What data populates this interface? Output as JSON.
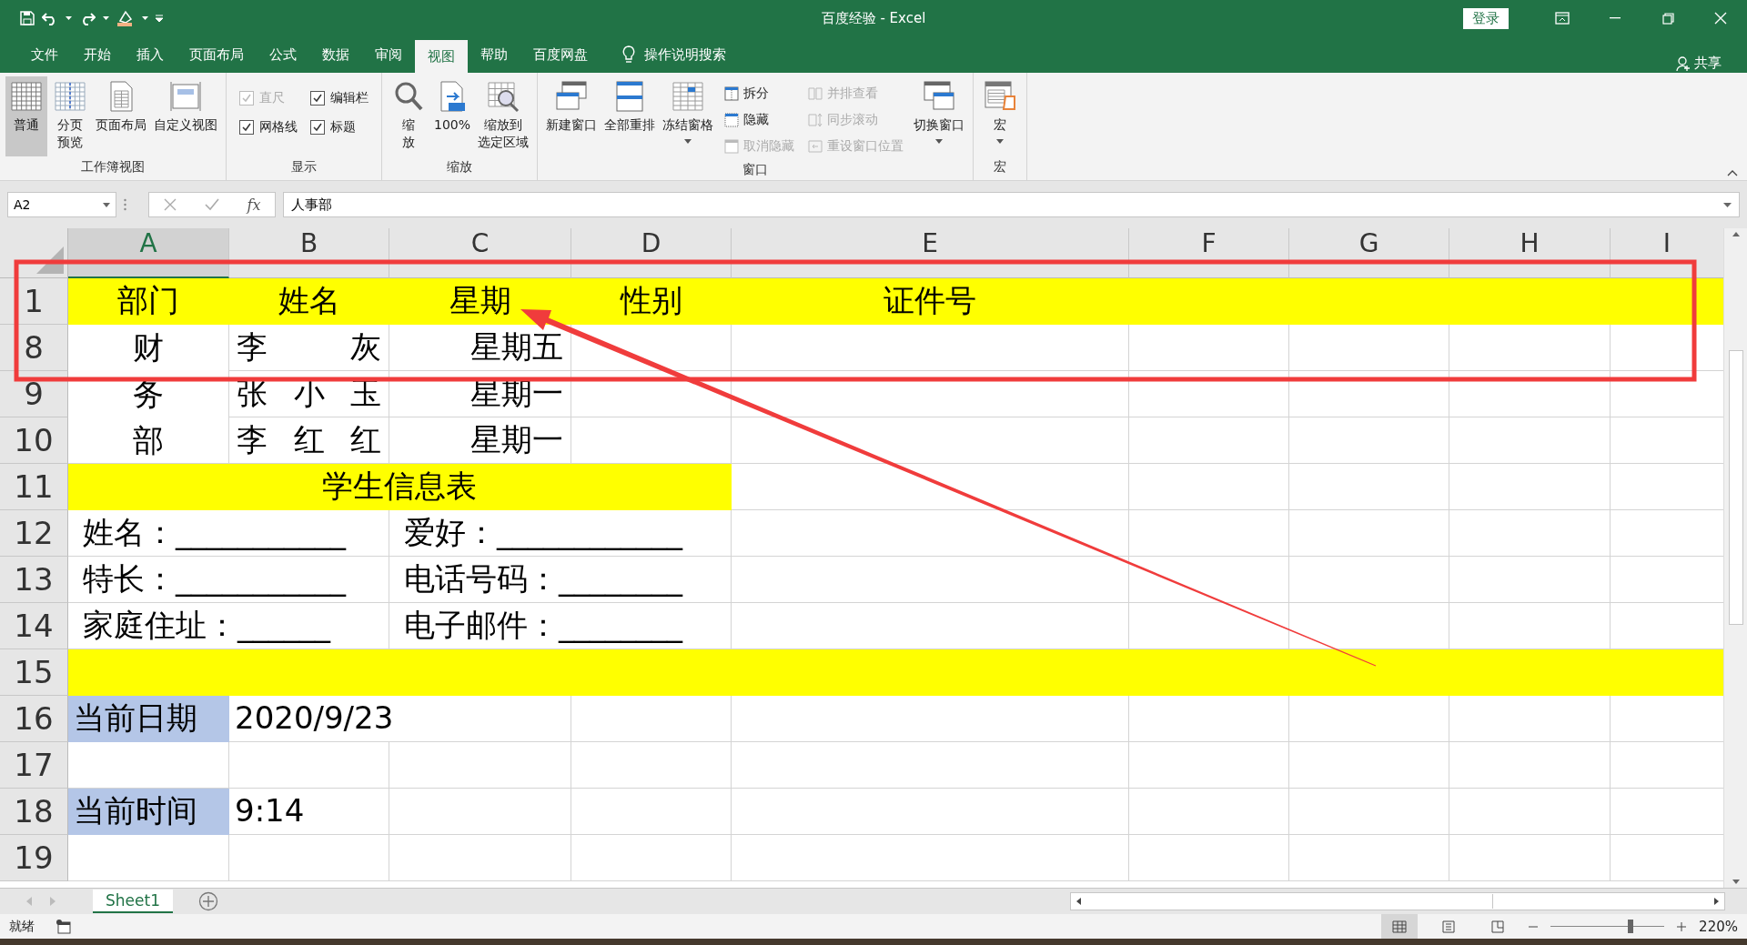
{
  "window": {
    "title": "百度经验 - Excel",
    "sign_in": "登录"
  },
  "ribbon_tabs": [
    {
      "label": "文件",
      "selected": false
    },
    {
      "label": "开始",
      "selected": false
    },
    {
      "label": "插入",
      "selected": false
    },
    {
      "label": "页面布局",
      "selected": false
    },
    {
      "label": "公式",
      "selected": false
    },
    {
      "label": "数据",
      "selected": false
    },
    {
      "label": "审阅",
      "selected": false
    },
    {
      "label": "视图",
      "selected": true
    },
    {
      "label": "帮助",
      "selected": false
    },
    {
      "label": "百度网盘",
      "selected": false
    }
  ],
  "tell_me": "操作说明搜索",
  "share": "共享",
  "ribbon_groups": [
    {
      "label": "工作簿视图",
      "items": [
        {
          "kind": "large",
          "label": "普通",
          "selected": true
        },
        {
          "kind": "large",
          "lines": [
            "分页",
            "预览"
          ],
          "selected": false
        },
        {
          "kind": "large",
          "label": "页面布局",
          "selected": false
        },
        {
          "kind": "large",
          "label": "自定义视图",
          "selected": false
        }
      ]
    },
    {
      "label": "显示",
      "items": [
        {
          "kind": "check",
          "label": "直尺",
          "checked": true,
          "disabled": true
        },
        {
          "kind": "check",
          "label": "网格线",
          "checked": true,
          "disabled": false
        },
        {
          "kind": "check",
          "label": "编辑栏",
          "checked": true,
          "disabled": false
        },
        {
          "kind": "check",
          "label": "标题",
          "checked": true,
          "disabled": false
        }
      ]
    },
    {
      "label": "缩放",
      "items": [
        {
          "kind": "large",
          "lines": [
            "缩",
            "放"
          ],
          "selected": false
        },
        {
          "kind": "large",
          "label": "100%",
          "selected": false
        },
        {
          "kind": "large",
          "lines": [
            "缩放到",
            "选定区域"
          ],
          "selected": false
        }
      ]
    },
    {
      "label": "窗口",
      "items": [
        {
          "kind": "large",
          "label": "新建窗口",
          "selected": false
        },
        {
          "kind": "large",
          "label": "全部重排",
          "selected": false
        },
        {
          "kind": "large",
          "label": "冻结窗格",
          "selected": false,
          "dropdown": true
        },
        {
          "kind": "small",
          "label": "拆分",
          "disabled": false
        },
        {
          "kind": "small",
          "label": "隐藏",
          "disabled": false
        },
        {
          "kind": "small",
          "label": "取消隐藏",
          "disabled": true
        },
        {
          "kind": "small",
          "label": "并排查看",
          "disabled": true
        },
        {
          "kind": "small",
          "label": "同步滚动",
          "disabled": true
        },
        {
          "kind": "small",
          "label": "重设窗口位置",
          "disabled": true
        },
        {
          "kind": "large",
          "label": "切换窗口",
          "selected": false,
          "dropdown": true
        }
      ]
    },
    {
      "label": "宏",
      "items": [
        {
          "kind": "large",
          "label": "宏",
          "selected": false,
          "dropdown": true
        }
      ]
    }
  ],
  "formula_bar": {
    "name_box": "A2",
    "function_label": "fx",
    "value": "人事部"
  },
  "columns": [
    {
      "label": "A",
      "selected": true
    },
    {
      "label": "B",
      "selected": false
    },
    {
      "label": "C",
      "selected": false
    },
    {
      "label": "D",
      "selected": false
    },
    {
      "label": "E",
      "selected": false
    },
    {
      "label": "F",
      "selected": false
    },
    {
      "label": "G",
      "selected": false
    },
    {
      "label": "H",
      "selected": false
    },
    {
      "label": "I",
      "selected": false
    }
  ],
  "rows": [
    {
      "number": "1",
      "cells": [
        {
          "text": "部门",
          "color": "#ffff00"
        },
        {
          "text": "姓名",
          "color": "#ffff00"
        },
        {
          "text": "星期",
          "color": "#ffff00"
        },
        {
          "text": "性别",
          "color": "#ffff00"
        },
        {
          "text": "证件号",
          "color": "#ffff00"
        },
        {
          "color": "#ffff00"
        }
      ]
    },
    {
      "number": "8",
      "cells": [
        {
          "text": "财务部"
        },
        {
          "text": "李灰"
        },
        {
          "text": "星期五"
        }
      ]
    },
    {
      "number": "9",
      "cells": [
        {
          "text": "张小玉"
        },
        {
          "text": "星期一"
        }
      ]
    },
    {
      "number": "10",
      "cells": [
        {
          "text": "李红红"
        },
        {
          "text": "星期一"
        }
      ]
    },
    {
      "number": "11",
      "cells": [
        {
          "text": "学生信息表",
          "color": "#ffff00"
        }
      ]
    },
    {
      "number": "12",
      "cells": [
        {
          "text": "姓名：___________"
        },
        {
          "text": "爱好：____________"
        }
      ]
    },
    {
      "number": "13",
      "cells": [
        {
          "text": "特长：___________"
        },
        {
          "text": "电话号码：________"
        }
      ]
    },
    {
      "number": "14",
      "cells": [
        {
          "text": "家庭住址：______"
        },
        {
          "text": "电子邮件：________"
        }
      ]
    },
    {
      "number": "15",
      "cells": [
        {
          "color": "#ffff00"
        }
      ]
    },
    {
      "number": "16",
      "cells": [
        {
          "text": "当前日期",
          "color": "#b4c6e7"
        },
        {
          "text": "2020/9/23"
        }
      ]
    },
    {
      "number": "17",
      "cells": []
    },
    {
      "number": "18",
      "cells": [
        {
          "text": "当前时间",
          "color": "#b4c6e7"
        },
        {
          "text": "9:14"
        }
      ]
    },
    {
      "number": "19",
      "cells": []
    }
  ],
  "sheet_tabs": [
    {
      "label": "Sheet1",
      "selected": true
    }
  ],
  "status_bar": {
    "status": "就绪",
    "zoom_slider": {
      "level": 0.7
    },
    "zoom": "220%"
  }
}
